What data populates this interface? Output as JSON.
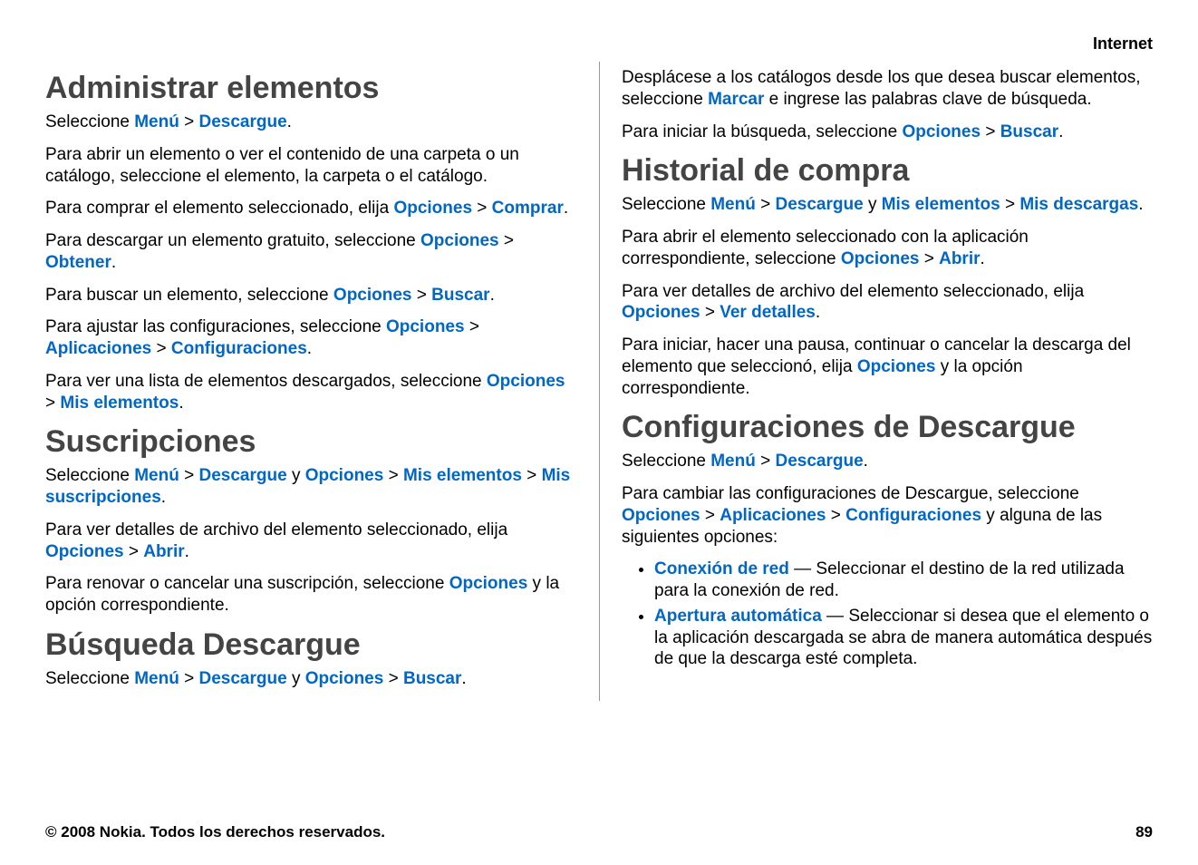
{
  "header": {
    "category": "Internet"
  },
  "left": {
    "h1": "Administrar elementos",
    "p1": {
      "pre": "Seleccione ",
      "k1": "Menú",
      "g1": " > ",
      "k2": "Descargue",
      "post": "."
    },
    "p2": "Para abrir un elemento o ver el contenido de una carpeta o un catálogo, seleccione el elemento, la carpeta o el catálogo.",
    "p3": {
      "pre": "Para comprar el elemento seleccionado, elija ",
      "k1": "Opciones",
      "g1": " > ",
      "k2": "Comprar",
      "post": "."
    },
    "p4": {
      "pre": "Para descargar un elemento gratuito, seleccione ",
      "k1": "Opciones",
      "g1": " > ",
      "k2": "Obtener",
      "post": "."
    },
    "p5": {
      "pre": "Para buscar un elemento, seleccione ",
      "k1": "Opciones",
      "g1": " > ",
      "k2": "Buscar",
      "post": "."
    },
    "p6": {
      "pre": "Para ajustar las configuraciones, seleccione ",
      "k1": "Opciones",
      "g1": " > ",
      "k2": "Aplicaciones",
      "g2": " > ",
      "k3": "Configuraciones",
      "post": "."
    },
    "p7": {
      "pre": "Para ver una lista de elementos descargados, seleccione ",
      "k1": "Opciones",
      "g1": " > ",
      "k2": "Mis elementos",
      "post": "."
    },
    "h2": "Suscripciones",
    "p8": {
      "pre": "Seleccione ",
      "k1": "Menú",
      "g1": " > ",
      "k2": "Descargue",
      "mid1": " y ",
      "k3": "Opciones",
      "g2": " > ",
      "k4": "Mis elementos",
      "g3": " > ",
      "k5": "Mis suscripciones",
      "post": "."
    },
    "p9": {
      "pre": "Para ver detalles de archivo del elemento seleccionado, elija ",
      "k1": "Opciones",
      "g1": " > ",
      "k2": "Abrir",
      "post": "."
    },
    "p10": {
      "pre": "Para renovar o cancelar una suscripción, seleccione ",
      "k1": "Opciones",
      "post": " y la opción correspondiente."
    },
    "h3": "Búsqueda Descargue",
    "p11": {
      "pre": "Seleccione ",
      "k1": "Menú",
      "g1": " > ",
      "k2": "Descargue",
      "mid1": " y ",
      "k3": "Opciones",
      "g2": " > ",
      "k4": "Buscar",
      "post": "."
    }
  },
  "right": {
    "p1": {
      "pre": "Desplácese a los catálogos desde los que desea buscar elementos, seleccione ",
      "k1": "Marcar",
      "post": " e ingrese las palabras clave de búsqueda."
    },
    "p2": {
      "pre": "Para iniciar la búsqueda, seleccione ",
      "k1": "Opciones",
      "g1": " > ",
      "k2": "Buscar",
      "post": "."
    },
    "h1": "Historial de compra",
    "p3": {
      "pre": "Seleccione ",
      "k1": "Menú",
      "g1": " > ",
      "k2": "Descargue",
      "mid1": " y ",
      "k3": "Mis elementos",
      "g2": " > ",
      "k4": "Mis descargas",
      "post": "."
    },
    "p4": {
      "pre": "Para abrir el elemento seleccionado con la aplicación correspondiente, seleccione ",
      "k1": "Opciones",
      "g1": " > ",
      "k2": "Abrir",
      "post": "."
    },
    "p5": {
      "pre": "Para ver detalles de archivo del elemento seleccionado, elija ",
      "k1": "Opciones",
      "g1": " > ",
      "k2": "Ver detalles",
      "post": "."
    },
    "p6": {
      "pre": "Para iniciar, hacer una pausa, continuar o cancelar la descarga del elemento que seleccionó, elija ",
      "k1": "Opciones",
      "post": " y la opción correspondiente."
    },
    "h2": "Configuraciones de Descargue",
    "p7": {
      "pre": "Seleccione ",
      "k1": "Menú",
      "g1": " > ",
      "k2": "Descargue",
      "post": "."
    },
    "p8": {
      "pre": "Para cambiar las configuraciones de Descargue, seleccione ",
      "k1": "Opciones",
      "g1": " > ",
      "k2": "Aplicaciones",
      "g2": " > ",
      "k3": "Configuraciones",
      "post": " y alguna de las siguientes opciones:"
    },
    "b1": {
      "k1": "Conexión de red",
      "post": "  —  Seleccionar el destino de la red utilizada para la conexión de red."
    },
    "b2": {
      "k1": "Apertura automática",
      "post": "  —  Seleccionar si desea que el elemento o la aplicación descargada se abra de manera automática después de que la descarga esté completa."
    }
  },
  "footer": {
    "copyright": "© 2008 Nokia. Todos los derechos reservados.",
    "page": "89"
  }
}
